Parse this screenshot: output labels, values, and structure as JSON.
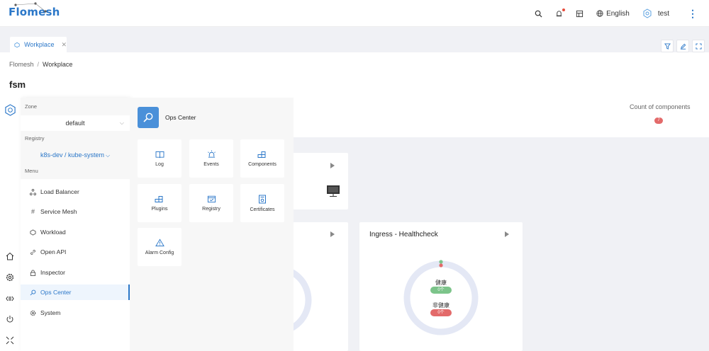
{
  "app": {
    "logo": "Flomesh"
  },
  "topbar": {
    "language": "English",
    "user": "test"
  },
  "tabs": [
    {
      "label": "Workplace"
    }
  ],
  "breadcrumb": {
    "root": "Flomesh",
    "sep": "/",
    "current": "Workplace"
  },
  "page_title": "fsm",
  "stats": {
    "count_label": "Count of components",
    "count_value": "7"
  },
  "sidebar": {
    "zone_label": "Zone",
    "zone_value": "default",
    "registry_label": "Registry",
    "registry_value": "k8s-dev / kube-system",
    "menu_label": "Menu",
    "items": [
      {
        "label": "Load Balancer",
        "icon": "cluster-icon"
      },
      {
        "label": "Service Mesh",
        "icon": "hash-icon"
      },
      {
        "label": "Workload",
        "icon": "hexagon-icon"
      },
      {
        "label": "Open API",
        "icon": "link-icon"
      },
      {
        "label": "Inspector",
        "icon": "lock-icon"
      },
      {
        "label": "Ops Center",
        "icon": "search-icon",
        "active": true
      },
      {
        "label": "System",
        "icon": "gear-icon"
      }
    ]
  },
  "ops_center": {
    "title": "Ops Center",
    "tiles": [
      {
        "label": "Log"
      },
      {
        "label": "Events"
      },
      {
        "label": "Components"
      },
      {
        "label": "Plugins"
      },
      {
        "label": "Registry"
      },
      {
        "label": "Certificates"
      },
      {
        "label": "Alarm Config"
      }
    ]
  },
  "cards": {
    "healthcheck_title": "Ingress - Healthcheck",
    "healthy_label": "健康",
    "healthy_count": "0个",
    "unhealthy_label": "非健康",
    "unhealthy_count": "0个"
  },
  "colors": {
    "accent": "#2b77c8",
    "healthy": "#7cc48a",
    "unhealthy": "#e36a6a",
    "ring": "#e4e8f5"
  }
}
